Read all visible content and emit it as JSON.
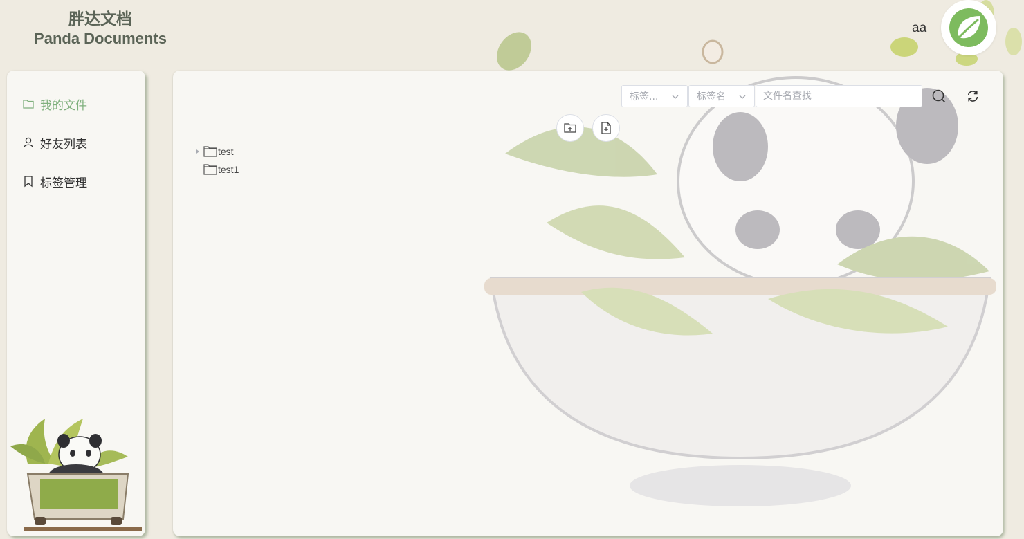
{
  "app": {
    "title_cn": "胖达文档",
    "title_en": "Panda Documents"
  },
  "user": {
    "name": "aa",
    "avatar_icon": "spring-leaf-icon"
  },
  "sidebar": {
    "items": [
      {
        "label": "我的文件",
        "icon": "folder-icon",
        "active": true
      },
      {
        "label": "好友列表",
        "icon": "user-icon",
        "active": false
      },
      {
        "label": "标签管理",
        "icon": "bookmark-icon",
        "active": false
      }
    ]
  },
  "toolbar": {
    "tag_type_placeholder": "标签...",
    "tag_name_placeholder": "标签名",
    "search_placeholder": "文件名查找",
    "search_icon": "search-icon",
    "refresh_icon": "refresh-icon",
    "new_folder_icon": "folder-add-icon",
    "new_file_icon": "file-add-icon"
  },
  "tree": {
    "nodes": [
      {
        "name": "test",
        "expandable": true
      },
      {
        "name": "test1",
        "expandable": false
      }
    ]
  },
  "colors": {
    "accent": "#7fb07d",
    "background": "#efebe1",
    "panel": "#f8f7f3",
    "brand_text": "#5b6457"
  }
}
